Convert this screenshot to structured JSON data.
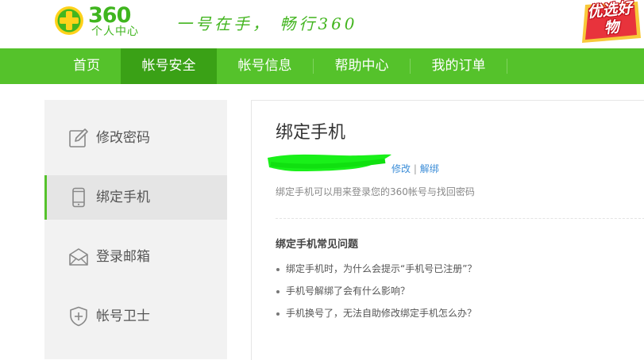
{
  "header": {
    "logo_number": "360",
    "logo_subtitle": "个人中心",
    "slogan": "一号在手， 畅行360",
    "promo_text": "优选好物"
  },
  "nav": {
    "items": [
      {
        "label": "首页"
      },
      {
        "label": "帐号安全"
      },
      {
        "label": "帐号信息"
      },
      {
        "label": "帮助中心"
      },
      {
        "label": "我的订单"
      }
    ],
    "active_index": 1
  },
  "sidebar": {
    "items": [
      {
        "label": "修改密码",
        "icon": "edit-icon"
      },
      {
        "label": "绑定手机",
        "icon": "phone-icon"
      },
      {
        "label": "登录邮箱",
        "icon": "mail-icon"
      },
      {
        "label": "帐号卫士",
        "icon": "shield-icon"
      }
    ],
    "active_index": 1
  },
  "main": {
    "title": "绑定手机",
    "modify_label": "修改",
    "separator": "|",
    "unbind_label": "解绑",
    "description": "绑定手机可以用来登录您的360帐号与找回密码",
    "faq_title": "绑定手机常见问题",
    "faq": [
      "绑定手机时，为什么会提示“手机号已注册”？",
      "手机号解绑了会有什么影响？",
      "手机换号了，无法自助修改绑定手机怎么办？"
    ]
  },
  "colors": {
    "brand_green": "#55c22b",
    "nav_active": "#3aa116",
    "link_blue": "#3d8ed8",
    "sidebar_bg": "#f2f2f2"
  }
}
